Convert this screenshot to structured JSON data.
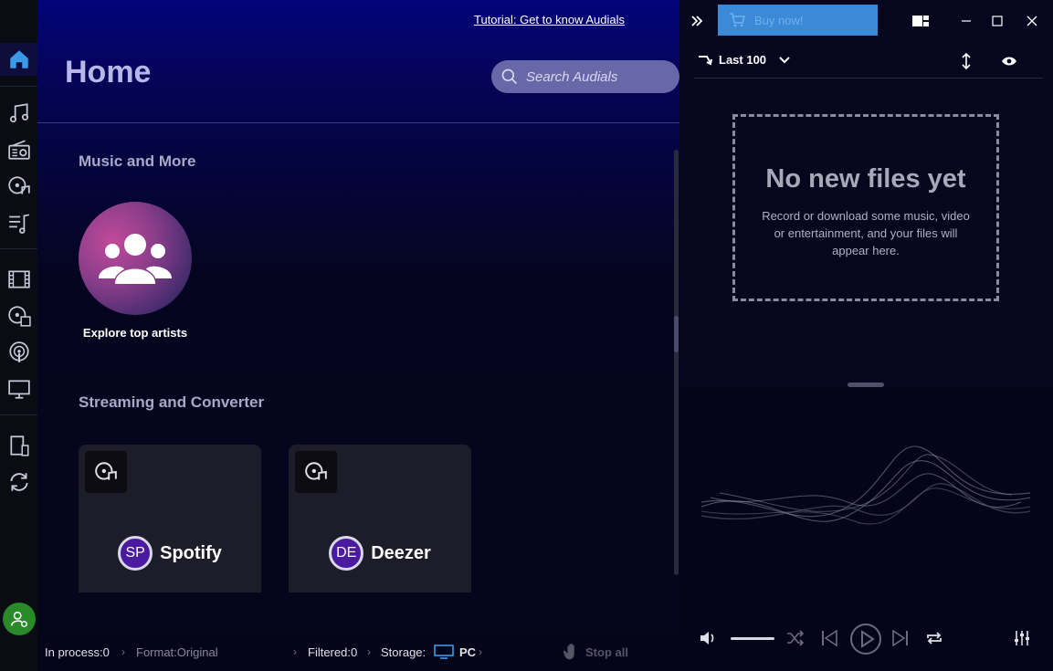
{
  "header": {
    "tutorial_link": "Tutorial: Get to know Audials",
    "page_title": "Home",
    "search_placeholder": "Search Audials"
  },
  "sections": {
    "music_and_more": "Music and More",
    "streaming_and_converter": "Streaming and Converter"
  },
  "artists_tile": {
    "label": "Explore top artists"
  },
  "services": [
    {
      "initials": "SP",
      "name": "Spotify"
    },
    {
      "initials": "DE",
      "name": "Deezer"
    }
  ],
  "statusbar": {
    "in_process": "In process:",
    "in_process_count": "0",
    "format": "Format:Original",
    "filtered": "Filtered:",
    "filtered_count": "0",
    "storage": "Storage:",
    "storage_value": "PC",
    "stop_all": "Stop all"
  },
  "right_panel": {
    "buy_label": "Buy now!",
    "filter_label": "Last 100",
    "empty_title": "No new files yet",
    "empty_desc": "Record or download some music, video or entertainment, and your files will appear here."
  },
  "colors": {
    "accent": "#3a8ad8",
    "service_badge": "#4a1aa0",
    "status_green": "#2a8a2a"
  }
}
